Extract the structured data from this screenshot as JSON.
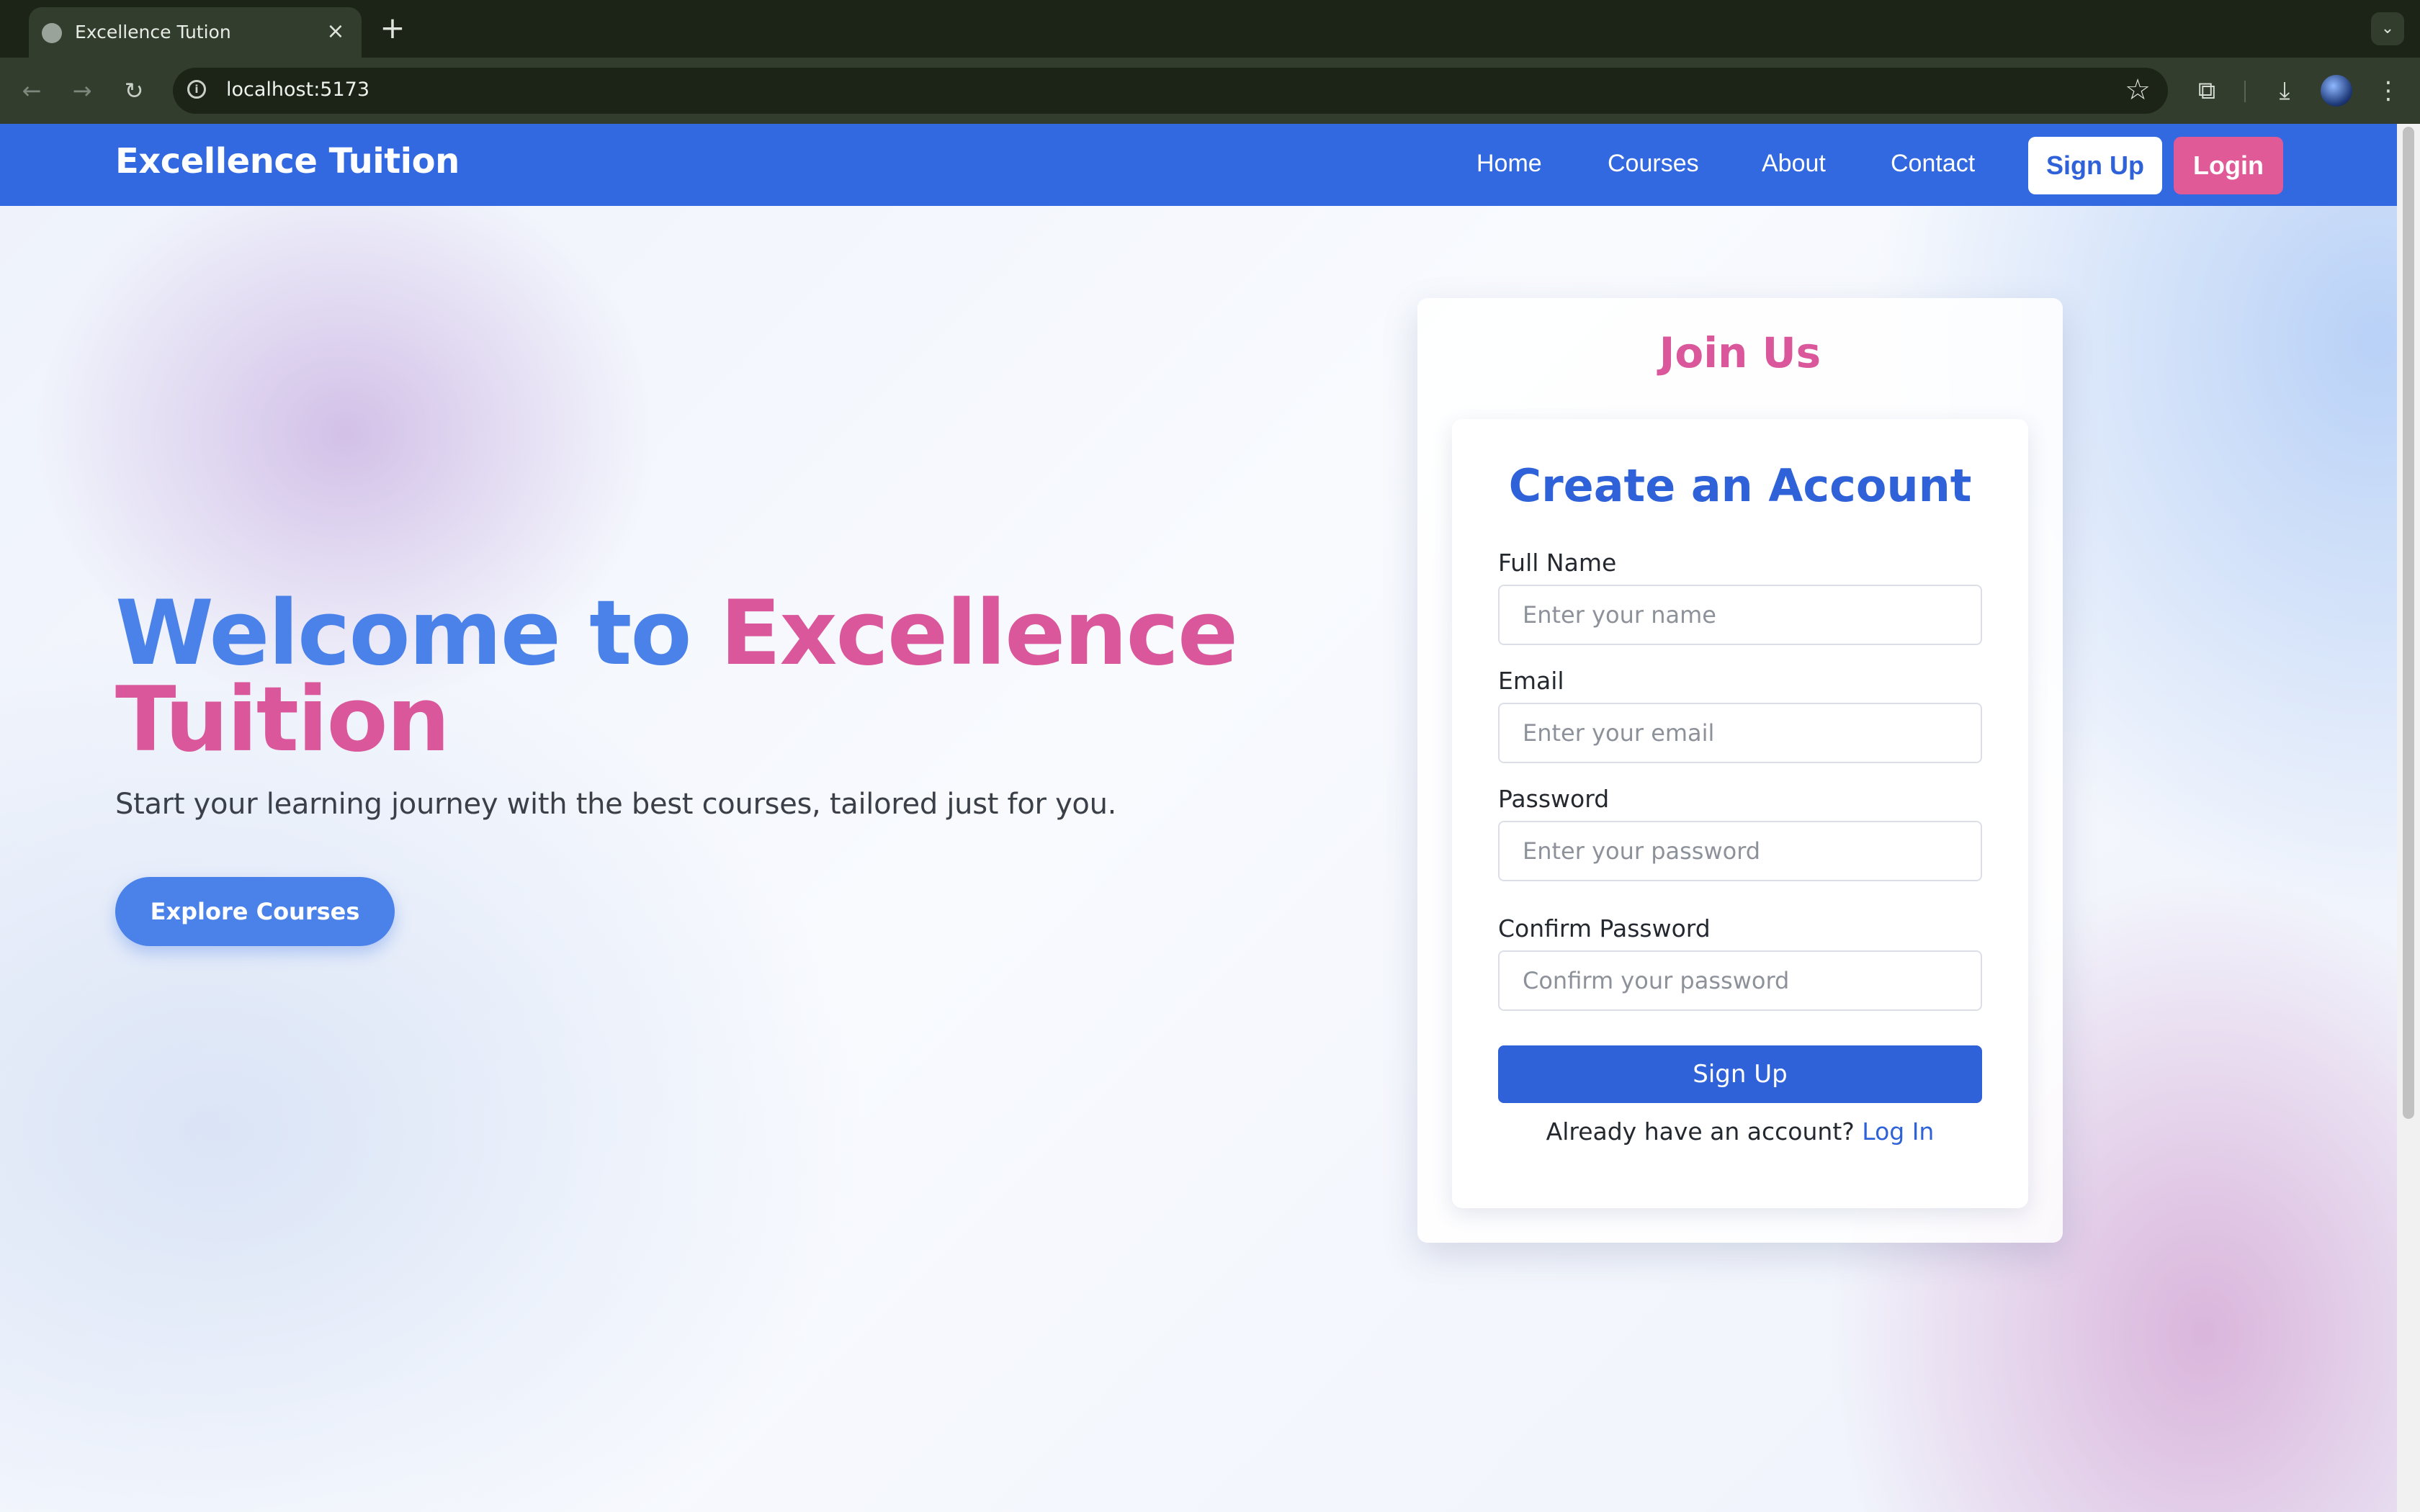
{
  "browser": {
    "tab_title": "Excellence Tution",
    "tab_close": "×",
    "new_tab": "+",
    "tab_menu": "⌄",
    "url": "localhost:5173",
    "back": "←",
    "forward": "→",
    "reload": "↻",
    "info": "i",
    "bookmark": "☆",
    "extensions": "⧉",
    "download": "⤓",
    "menu": "⋮"
  },
  "nav": {
    "brand": "Excellence Tuition",
    "links": [
      "Home",
      "Courses",
      "About",
      "Contact"
    ],
    "signup_label": "Sign Up",
    "login_label": "Login"
  },
  "hero": {
    "title_part1": "Welcome to ",
    "title_part2": "Excellence Tuition",
    "subtitle": "Start your learning journey with the best courses, tailored just for you.",
    "cta_label": "Explore Courses"
  },
  "join": {
    "title": "Join Us",
    "form_heading": "Create an Account",
    "fields": [
      {
        "label": "Full Name",
        "placeholder": "Enter your name"
      },
      {
        "label": "Email",
        "placeholder": "Enter your email"
      },
      {
        "label": "Password",
        "placeholder": "Enter your password"
      },
      {
        "label": "Confirm Password",
        "placeholder": "Confirm your password"
      }
    ],
    "submit_label": "Sign Up",
    "login_prompt": "Already have an account? ",
    "login_link": "Log In"
  },
  "colors": {
    "primary_blue": "#3369e0",
    "accent_pink": "#e05a97",
    "hero_blue": "#4a82ea"
  }
}
